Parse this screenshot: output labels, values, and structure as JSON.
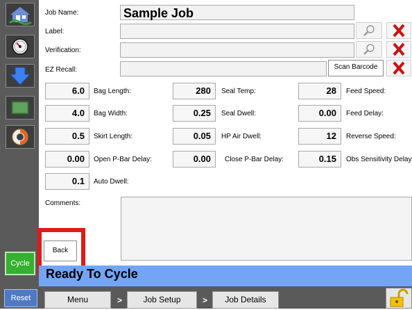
{
  "sidebar": {
    "items": [
      {
        "name": "home-icon"
      },
      {
        "name": "gauge-icon"
      },
      {
        "name": "arrow-down-icon"
      },
      {
        "name": "screen-icon"
      },
      {
        "name": "lifebuoy-icon"
      }
    ],
    "cycle_label": "Cycle",
    "reset_label": "Reset"
  },
  "job": {
    "name_label": "Job Name:",
    "name_value": "Sample Job",
    "label_label": "Label:",
    "verification_label": "Verification:",
    "ez_recall_label": "EZ Recall:",
    "scan_barcode_label": "Scan Barcode"
  },
  "params": {
    "col1": [
      {
        "value": "6.0",
        "label": "Bag Length:"
      },
      {
        "value": "4.0",
        "label": "Bag Width:"
      },
      {
        "value": "0.5",
        "label": "Skirt Length:"
      },
      {
        "value": "0.00",
        "label": "Open P-Bar Delay:"
      },
      {
        "value": "0.1",
        "label": "Auto Dwell:"
      }
    ],
    "col2": [
      {
        "value": "280",
        "label": "Seal Temp:"
      },
      {
        "value": "0.25",
        "label": "Seal Dwell:"
      },
      {
        "value": "0.05",
        "label": "HP Air Dwell:"
      },
      {
        "value": "0.00",
        "label": "Close P-Bar Delay:"
      }
    ],
    "col3": [
      {
        "value": "28",
        "label": "Feed Speed:"
      },
      {
        "value": "0.00",
        "label": "Feed Delay:"
      },
      {
        "value": "12",
        "label": "Reverse Speed:"
      },
      {
        "value": "0.15",
        "label": "Obs Sensitivity Delay"
      }
    ]
  },
  "comments": {
    "label": "Comments:",
    "value": ""
  },
  "back_label": "Back",
  "status_text": "Ready To Cycle",
  "bottom_nav": {
    "menu_label": "Menu",
    "job_setup_label": "Job Setup",
    "job_details_label": "Job Details",
    "separator": ">"
  },
  "colors": {
    "status_bar": "#74a4f6",
    "cycle_button": "#35b030",
    "highlight_box": "#e01a1a",
    "delete_x": "#cc1111"
  }
}
